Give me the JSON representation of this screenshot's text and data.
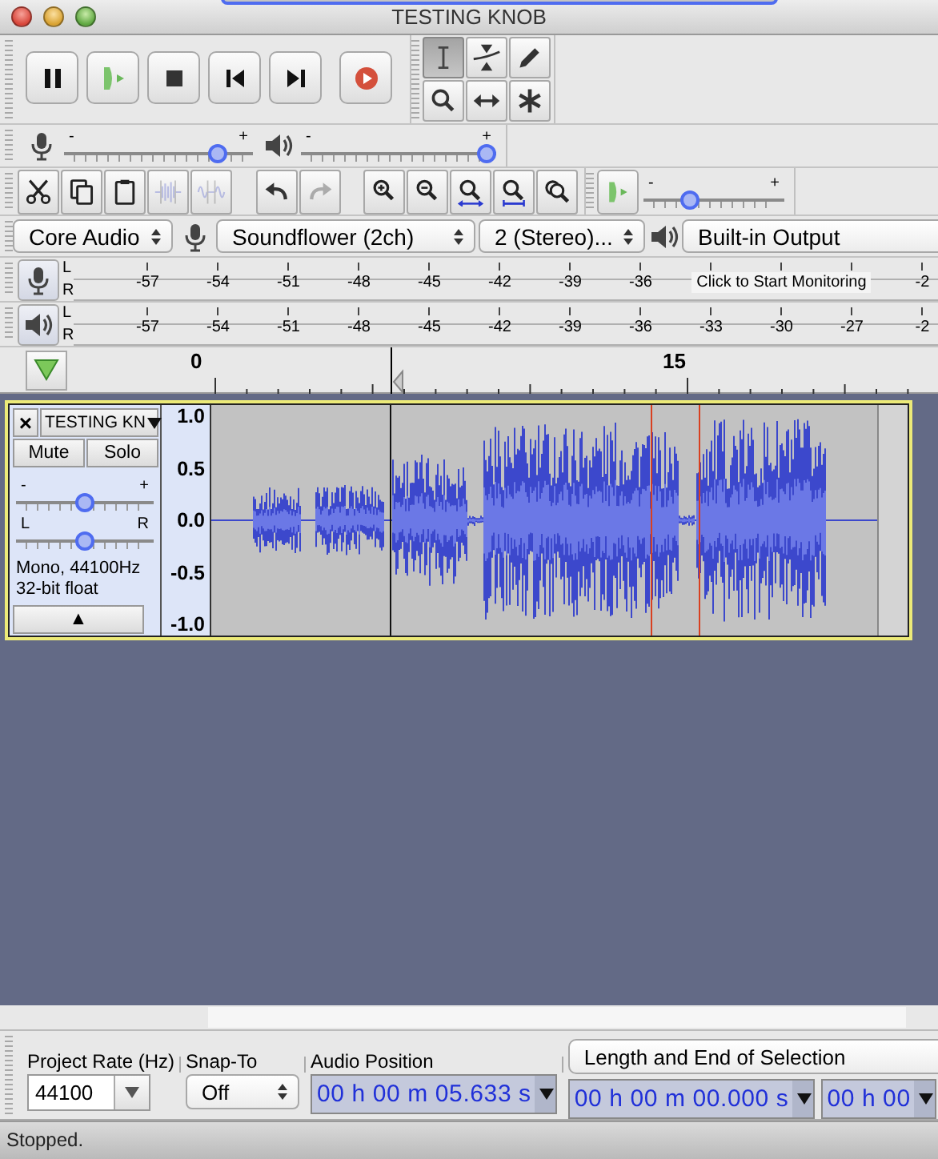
{
  "window": {
    "title": "TESTING KNOB"
  },
  "transport": [
    {
      "kind": "pause"
    },
    {
      "kind": "play"
    },
    {
      "kind": "stop"
    },
    {
      "kind": "skip-start"
    },
    {
      "kind": "skip-end"
    },
    {
      "kind": "record"
    }
  ],
  "tools": [
    {
      "kind": "select",
      "selected": true
    },
    {
      "kind": "envelope",
      "selected": false
    },
    {
      "kind": "draw",
      "selected": false
    },
    {
      "kind": "zoom",
      "selected": false
    },
    {
      "kind": "time-shift",
      "selected": false
    },
    {
      "kind": "multi",
      "selected": false
    }
  ],
  "mixer": [
    {
      "kind": "recording",
      "min_label": "-",
      "max_label": "+",
      "level": 0.85
    },
    {
      "kind": "playback",
      "min_label": "-",
      "max_label": "+",
      "level": 1
    }
  ],
  "edit_toolbar": {
    "groups": [
      [
        {
          "kind": "cut",
          "disabled": false
        },
        {
          "kind": "copy",
          "disabled": false
        },
        {
          "kind": "paste",
          "disabled": false
        },
        {
          "kind": "trim",
          "disabled": true
        },
        {
          "kind": "silence",
          "disabled": true
        }
      ],
      [
        {
          "kind": "undo",
          "disabled": false
        },
        {
          "kind": "redo",
          "disabled": true
        }
      ],
      [
        {
          "kind": "zoom-in",
          "disabled": false
        },
        {
          "kind": "zoom-out",
          "disabled": false
        },
        {
          "kind": "fit-selection",
          "disabled": false
        },
        {
          "kind": "fit-project",
          "disabled": false
        },
        {
          "kind": "zoom-toggle",
          "disabled": false
        }
      ]
    ],
    "play_at_speed": {
      "min_label": "-",
      "max_label": "+",
      "level": 0.3
    }
  },
  "devices": {
    "host": "Core Audio",
    "input": "Soundflower (2ch)",
    "channels": "2 (Stereo)...",
    "output": "Built-in Output"
  },
  "meters": [
    {
      "kind": "recording",
      "channels": [
        "L",
        "R"
      ],
      "items": [
        {
          "kind": "tick",
          "text": "-57"
        },
        {
          "kind": "tick",
          "text": "-54"
        },
        {
          "kind": "tick",
          "text": "-51"
        },
        {
          "kind": "tick",
          "text": "-48"
        },
        {
          "kind": "tick",
          "text": "-45"
        },
        {
          "kind": "tick",
          "text": "-42"
        },
        {
          "kind": "tick",
          "text": "-39"
        },
        {
          "kind": "tick",
          "text": "-36"
        },
        {
          "kind": "prompt",
          "text": "Click to Start Monitoring"
        },
        {
          "kind": "tick",
          "text": "-2"
        }
      ]
    },
    {
      "kind": "playback",
      "channels": [
        "L",
        "R"
      ],
      "items": [
        {
          "kind": "tick",
          "text": "-57"
        },
        {
          "kind": "tick",
          "text": "-54"
        },
        {
          "kind": "tick",
          "text": "-51"
        },
        {
          "kind": "tick",
          "text": "-48"
        },
        {
          "kind": "tick",
          "text": "-45"
        },
        {
          "kind": "tick",
          "text": "-42"
        },
        {
          "kind": "tick",
          "text": "-39"
        },
        {
          "kind": "tick",
          "text": "-36"
        },
        {
          "kind": "tick",
          "text": "-33"
        },
        {
          "kind": "tick",
          "text": "-30"
        },
        {
          "kind": "tick",
          "text": "-27"
        },
        {
          "kind": "tick",
          "text": "-2"
        }
      ]
    }
  ],
  "timeline": {
    "labels": [
      "0",
      "15"
    ]
  },
  "track": {
    "close": "×",
    "name": "TESTING KN",
    "mute": "Mute",
    "solo": "Solo",
    "gain": {
      "min_label": "-",
      "max_label": "+",
      "level": 0.5
    },
    "pan": {
      "min_label": "L",
      "max_label": "R",
      "level": 0.5
    },
    "info": [
      "Mono, 44100Hz",
      "32-bit float"
    ],
    "collapse": "▲",
    "axis": [
      "1.0",
      "0.5",
      "0.0",
      "-0.5",
      "-1.0"
    ]
  },
  "selection_toolbar": {
    "project_rate": {
      "label": "Project Rate (Hz)",
      "value": "44100"
    },
    "snap_to": {
      "label": "Snap-To",
      "value": "Off"
    },
    "audio_position": {
      "label": "Audio Position",
      "value": "00 h 00 m 05.633 s"
    },
    "selection": {
      "mode": "Length and End of Selection",
      "values": [
        "00 h 00 m 00.000 s",
        "00 h 00"
      ]
    }
  },
  "status_bar": "Stopped."
}
